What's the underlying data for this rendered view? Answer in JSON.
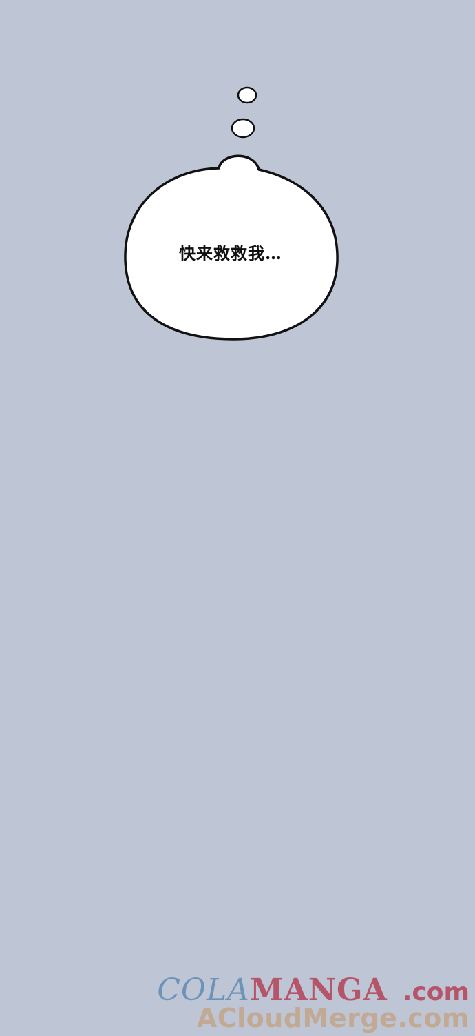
{
  "speech_bubble": {
    "text": "快来救救我…"
  },
  "watermark": {
    "brand_part1": "COLA",
    "brand_part2": "MANGA",
    "brand_suffix": ".com",
    "site": "ACloudMerge.com"
  },
  "colors": {
    "background": "#bec5d5",
    "bubble_fill": "#ffffff",
    "bubble_outline": "#111111",
    "watermark_blue": "#6d93b8",
    "watermark_red": "#b5556a",
    "watermark_tan": "#c2a994"
  }
}
